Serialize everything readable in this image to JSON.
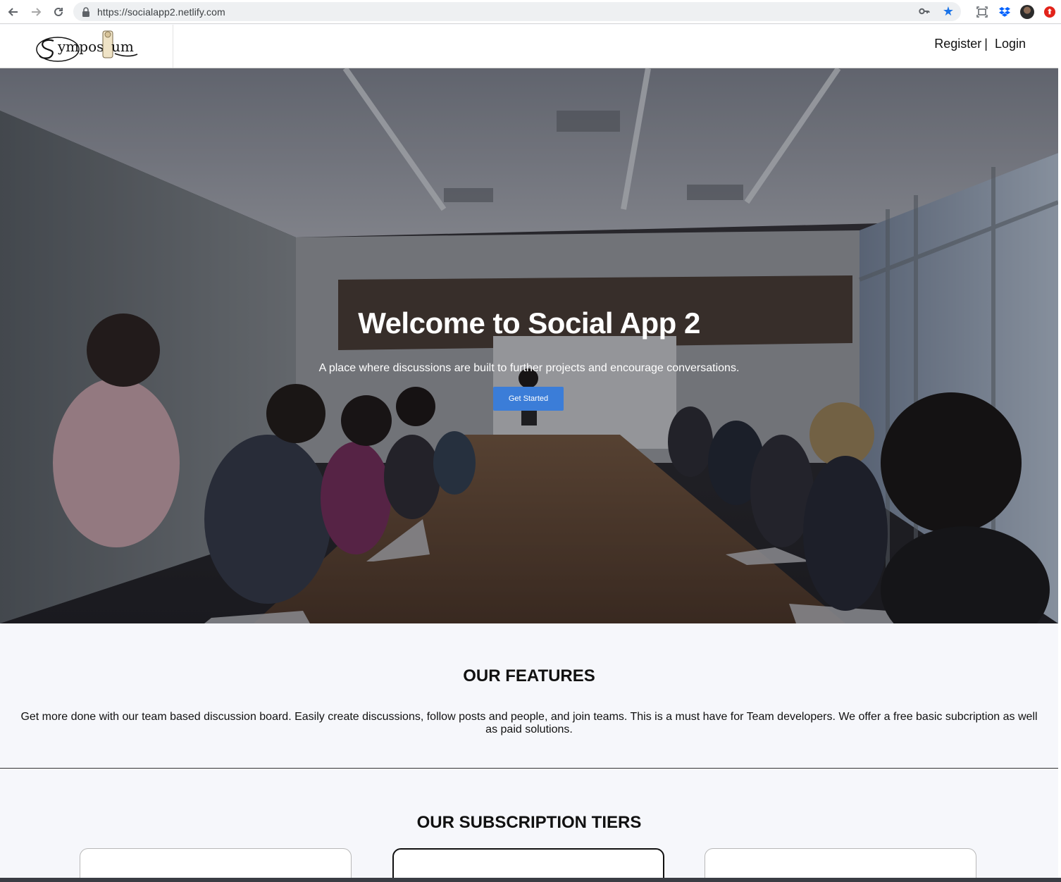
{
  "browser": {
    "url": "https://socialapp2.netlify.com",
    "back_icon": "arrow-left-icon",
    "forward_icon": "arrow-right-icon",
    "reload_icon": "reload-icon",
    "star_color": "#1a73e8"
  },
  "header": {
    "logo_text": "Symposium",
    "register_label": "Register",
    "separator": "|",
    "login_label": "Login"
  },
  "hero": {
    "title": "Welcome to Social App 2",
    "subtitle": "A place where discussions are built to further projects and encourage conversations.",
    "cta_label": "Get Started",
    "cta_color": "#3b7dd8"
  },
  "features": {
    "heading": "OUR FEATURES",
    "body": "Get more done with our team based discussion board. Easily create discussions, follow posts and people, and join teams. This is a must have for Team developers. We offer a free basic subcription as well as paid solutions."
  },
  "tiers": {
    "heading": "OUR SUBSCRIPTION TIERS"
  }
}
